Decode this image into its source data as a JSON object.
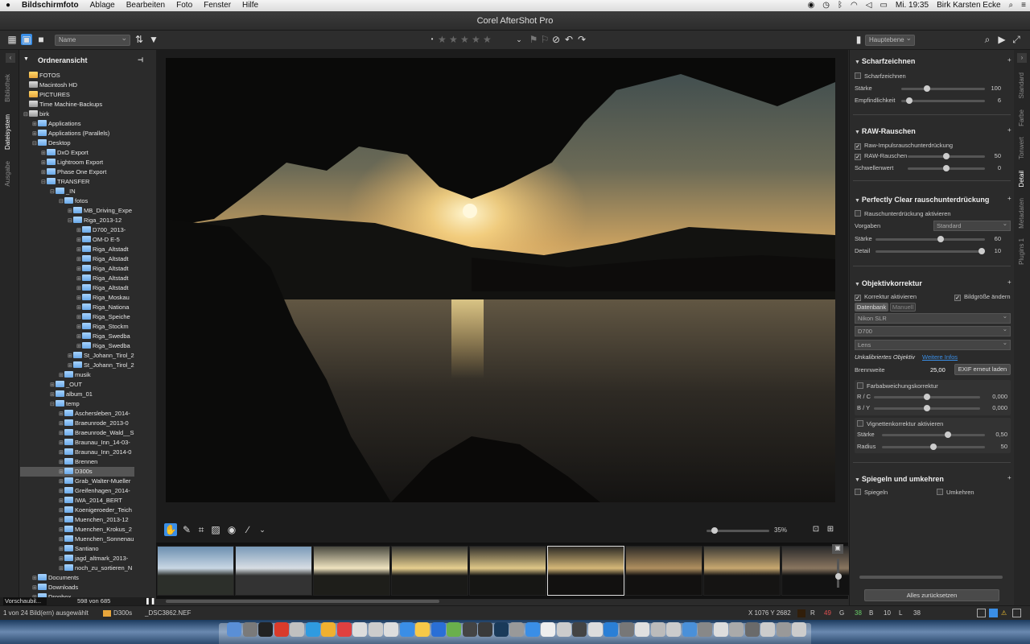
{
  "menubar": {
    "app": "Bildschirmfoto",
    "items": [
      "Ablage",
      "Bearbeiten",
      "Foto",
      "Fenster",
      "Hilfe"
    ],
    "clock": "Mi. 19:35",
    "user": "Birk Karsten Ecke"
  },
  "window": {
    "title": "Corel AfterShot Pro"
  },
  "toolbar": {
    "sort_select": "Name",
    "layer_select": "Hauptebene"
  },
  "left_tabs": [
    "Bibliothek",
    "Dateisystem",
    "Ausgabe"
  ],
  "left_panel": {
    "title": "Ordneransicht",
    "tree": [
      {
        "label": "FOTOS",
        "depth": 0,
        "icon": "yellow"
      },
      {
        "label": "Macintosh HD",
        "depth": 0,
        "icon": "drive"
      },
      {
        "label": "PICTURES",
        "depth": 0,
        "icon": "yellow"
      },
      {
        "label": "Time Machine-Backups",
        "depth": 0,
        "icon": "drive"
      },
      {
        "label": "birk",
        "depth": 0,
        "icon": "drive",
        "open": true
      },
      {
        "label": "Applications",
        "depth": 1
      },
      {
        "label": "Applications (Parallels)",
        "depth": 1
      },
      {
        "label": "Desktop",
        "depth": 1,
        "open": true
      },
      {
        "label": "DxO Export",
        "depth": 2
      },
      {
        "label": "Lightroom Export",
        "depth": 2
      },
      {
        "label": "Phase One Export",
        "depth": 2
      },
      {
        "label": "TRANSFER",
        "depth": 2,
        "open": true
      },
      {
        "label": "_IN",
        "depth": 3,
        "open": true
      },
      {
        "label": "fotos",
        "depth": 4,
        "open": true
      },
      {
        "label": "MB_Driving_Expe",
        "depth": 5
      },
      {
        "label": "Riga_2013-12",
        "depth": 5,
        "open": true
      },
      {
        "label": "D700_2013-",
        "depth": 6
      },
      {
        "label": "OM-D E-5",
        "depth": 6
      },
      {
        "label": "Riga_Altstadt",
        "depth": 6
      },
      {
        "label": "Riga_Altstadt",
        "depth": 6
      },
      {
        "label": "Riga_Altstadt",
        "depth": 6
      },
      {
        "label": "Riga_Altstadt",
        "depth": 6
      },
      {
        "label": "Riga_Altstadt",
        "depth": 6
      },
      {
        "label": "Riga_Moskau",
        "depth": 6
      },
      {
        "label": "Riga_Nationa",
        "depth": 6
      },
      {
        "label": "Riga_Speiche",
        "depth": 6
      },
      {
        "label": "Riga_Stockm",
        "depth": 6
      },
      {
        "label": "Riga_Swedba",
        "depth": 6
      },
      {
        "label": "Riga_Swedba",
        "depth": 6
      },
      {
        "label": "St_Johann_Tirol_2",
        "depth": 5
      },
      {
        "label": "St_Johann_Tirol_2",
        "depth": 5
      },
      {
        "label": "musik",
        "depth": 4
      },
      {
        "label": "_OUT",
        "depth": 3
      },
      {
        "label": "album_01",
        "depth": 3
      },
      {
        "label": "temp",
        "depth": 3,
        "open": true
      },
      {
        "label": "Aschersleben_2014-",
        "depth": 4
      },
      {
        "label": "Braeunrode_2013-0",
        "depth": 4
      },
      {
        "label": "Braeunrode_Wald__S",
        "depth": 4
      },
      {
        "label": "Braunau_Inn_14-03-",
        "depth": 4
      },
      {
        "label": "Braunau_Inn_2014-0",
        "depth": 4
      },
      {
        "label": "Brennen",
        "depth": 4
      },
      {
        "label": "D300s",
        "depth": 4,
        "selected": true
      },
      {
        "label": "Grab_Walter-Mueller",
        "depth": 4
      },
      {
        "label": "Greifenhagen_2014-",
        "depth": 4
      },
      {
        "label": "IWA_2014_BERT",
        "depth": 4
      },
      {
        "label": "Koenigeroeder_Teich",
        "depth": 4
      },
      {
        "label": "Muenchen_2013-12",
        "depth": 4
      },
      {
        "label": "Muenchen_Krokus_2",
        "depth": 4
      },
      {
        "label": "Muenchen_Sonnenau",
        "depth": 4
      },
      {
        "label": "Santiano",
        "depth": 4
      },
      {
        "label": "jagd_altmark_2013-",
        "depth": 4
      },
      {
        "label": "noch_zu_sortieren_N",
        "depth": 4
      },
      {
        "label": "Documents",
        "depth": 1
      },
      {
        "label": "Downloads",
        "depth": 1
      },
      {
        "label": "Dropbox",
        "depth": 1
      }
    ],
    "preview_label": "Vorschaubil...",
    "preview_count": "598 von 685"
  },
  "viewer": {
    "zoom": "35%"
  },
  "status": {
    "selection": "1 von 24 Bild(ern) ausgewählt",
    "folder": "D300s",
    "file": "_DSC3862.NEF",
    "coords": "X 1076  Y 2682",
    "r_label": "R",
    "r": "49",
    "g_label": "G",
    "g": "38",
    "b_label": "B",
    "b": "10",
    "l_label": "L",
    "l": "38"
  },
  "right_tabs": [
    "Standard",
    "Farbe",
    "Tonwert",
    "Detail",
    "Metadaten",
    "Plugins 1"
  ],
  "sharpen": {
    "title": "Scharfzeichnen",
    "enable": "Scharfzeichnen",
    "staerke_label": "Stärke",
    "staerke": "100",
    "staerke_frac": 0.29,
    "empf_label": "Empfindlichkeit",
    "empf": "6",
    "empf_frac": 0.06
  },
  "raw_noise": {
    "title": "RAW-Rauschen",
    "impulse": "Raw-Impulsrauschunterdrückung",
    "raw_label": "RAW-Rauschen",
    "raw": "50",
    "raw_frac": 0.5,
    "thresh_label": "Schwellenwert",
    "thresh": "0",
    "thresh_frac": 0.5
  },
  "perfectly_clear": {
    "title": "Perfectly Clear rauschunterdrückung",
    "enable": "Rauschunterdrückung aktivieren",
    "vorgaben_label": "Vorgaben",
    "vorgaben": "Standard",
    "staerke_label": "Stärke",
    "staerke": "60",
    "staerke_frac": 0.6,
    "detail_label": "Detail",
    "detail": "10",
    "detail_frac": 1.0
  },
  "lens": {
    "title": "Objektivkorrektur",
    "enable": "Korrektur aktivieren",
    "resize": "Bildgröße ändern",
    "tab_db": "Datenbank",
    "tab_manual": "Manuell",
    "camera_brand": "Nikon SLR",
    "camera": "D700",
    "lens": "Lens",
    "uncal": "Unkalibriertes Objektiv",
    "more": "Weitere Infos",
    "focal_label": "Brennweite",
    "focal": "25,00",
    "exif_btn": "EXIF erneut laden",
    "ca_title": "Farbabweichungskorrektur",
    "rc_label": "R / C",
    "rc": "0,000",
    "by_label": "B / Y",
    "by": "0,000",
    "vig_title": "Vignettenkorrektur aktivieren",
    "vstaerke_label": "Stärke",
    "vstaerke": "0,50",
    "vstaerke_frac": 0.65,
    "radius_label": "Radius",
    "radius": "50",
    "radius_frac": 0.5
  },
  "mirror": {
    "title": "Spiegeln und umkehren",
    "spiegeln": "Spiegeln",
    "umkehren": "Umkehren"
  },
  "reset_btn": "Alles zurücksetzen",
  "colors": {
    "accent": "#3a8ee6",
    "bg": "#2b2b2b",
    "selected": "#555555"
  }
}
